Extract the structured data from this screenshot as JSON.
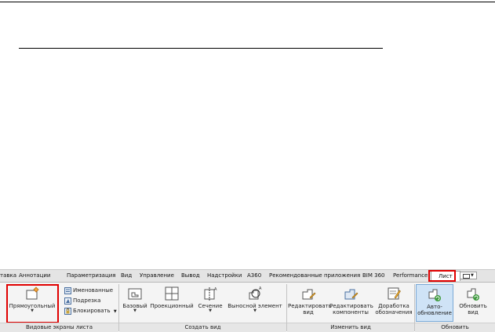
{
  "tabs": [
    {
      "key": "tab-vstavka",
      "label": "тавка"
    },
    {
      "key": "tab-annotations",
      "label": "Аннотации"
    },
    {
      "key": "tab-parametrization",
      "label": "Параметризация"
    },
    {
      "key": "tab-view",
      "label": "Вид"
    },
    {
      "key": "tab-manage",
      "label": "Управление"
    },
    {
      "key": "tab-output",
      "label": "Вывод"
    },
    {
      "key": "tab-addins",
      "label": "Надстройки"
    },
    {
      "key": "tab-a360",
      "label": "A360"
    },
    {
      "key": "tab-featured-apps",
      "label": "Рекомендованные приложения"
    },
    {
      "key": "tab-bim360",
      "label": "BIM 360"
    },
    {
      "key": "tab-performance",
      "label": "Performance"
    }
  ],
  "active_tab": "Лист",
  "highlight_color": "#e00000",
  "panels": {
    "viewports": {
      "title": "Видовые экраны листа",
      "rectangular": "Прямоугольный",
      "named": "Именованные",
      "clip": "Подрезка",
      "lock": "Блокировать"
    },
    "create_view": {
      "title": "Создать вид",
      "base": "Базовый",
      "projected": "Проекционный",
      "section": "Сечение",
      "detail": "Выносной элемент"
    },
    "modify_view": {
      "title": "Изменить вид",
      "edit_view": [
        "Редактировать",
        "вид"
      ],
      "edit_components": [
        "Редактировать",
        "компоненты"
      ],
      "annotation_monitor": [
        "Доработка",
        "обозначения"
      ]
    },
    "update": {
      "title": "Обновить",
      "auto_update": [
        "Авто-",
        "обновление"
      ],
      "update_view": [
        "Обновить",
        "вид"
      ]
    }
  }
}
